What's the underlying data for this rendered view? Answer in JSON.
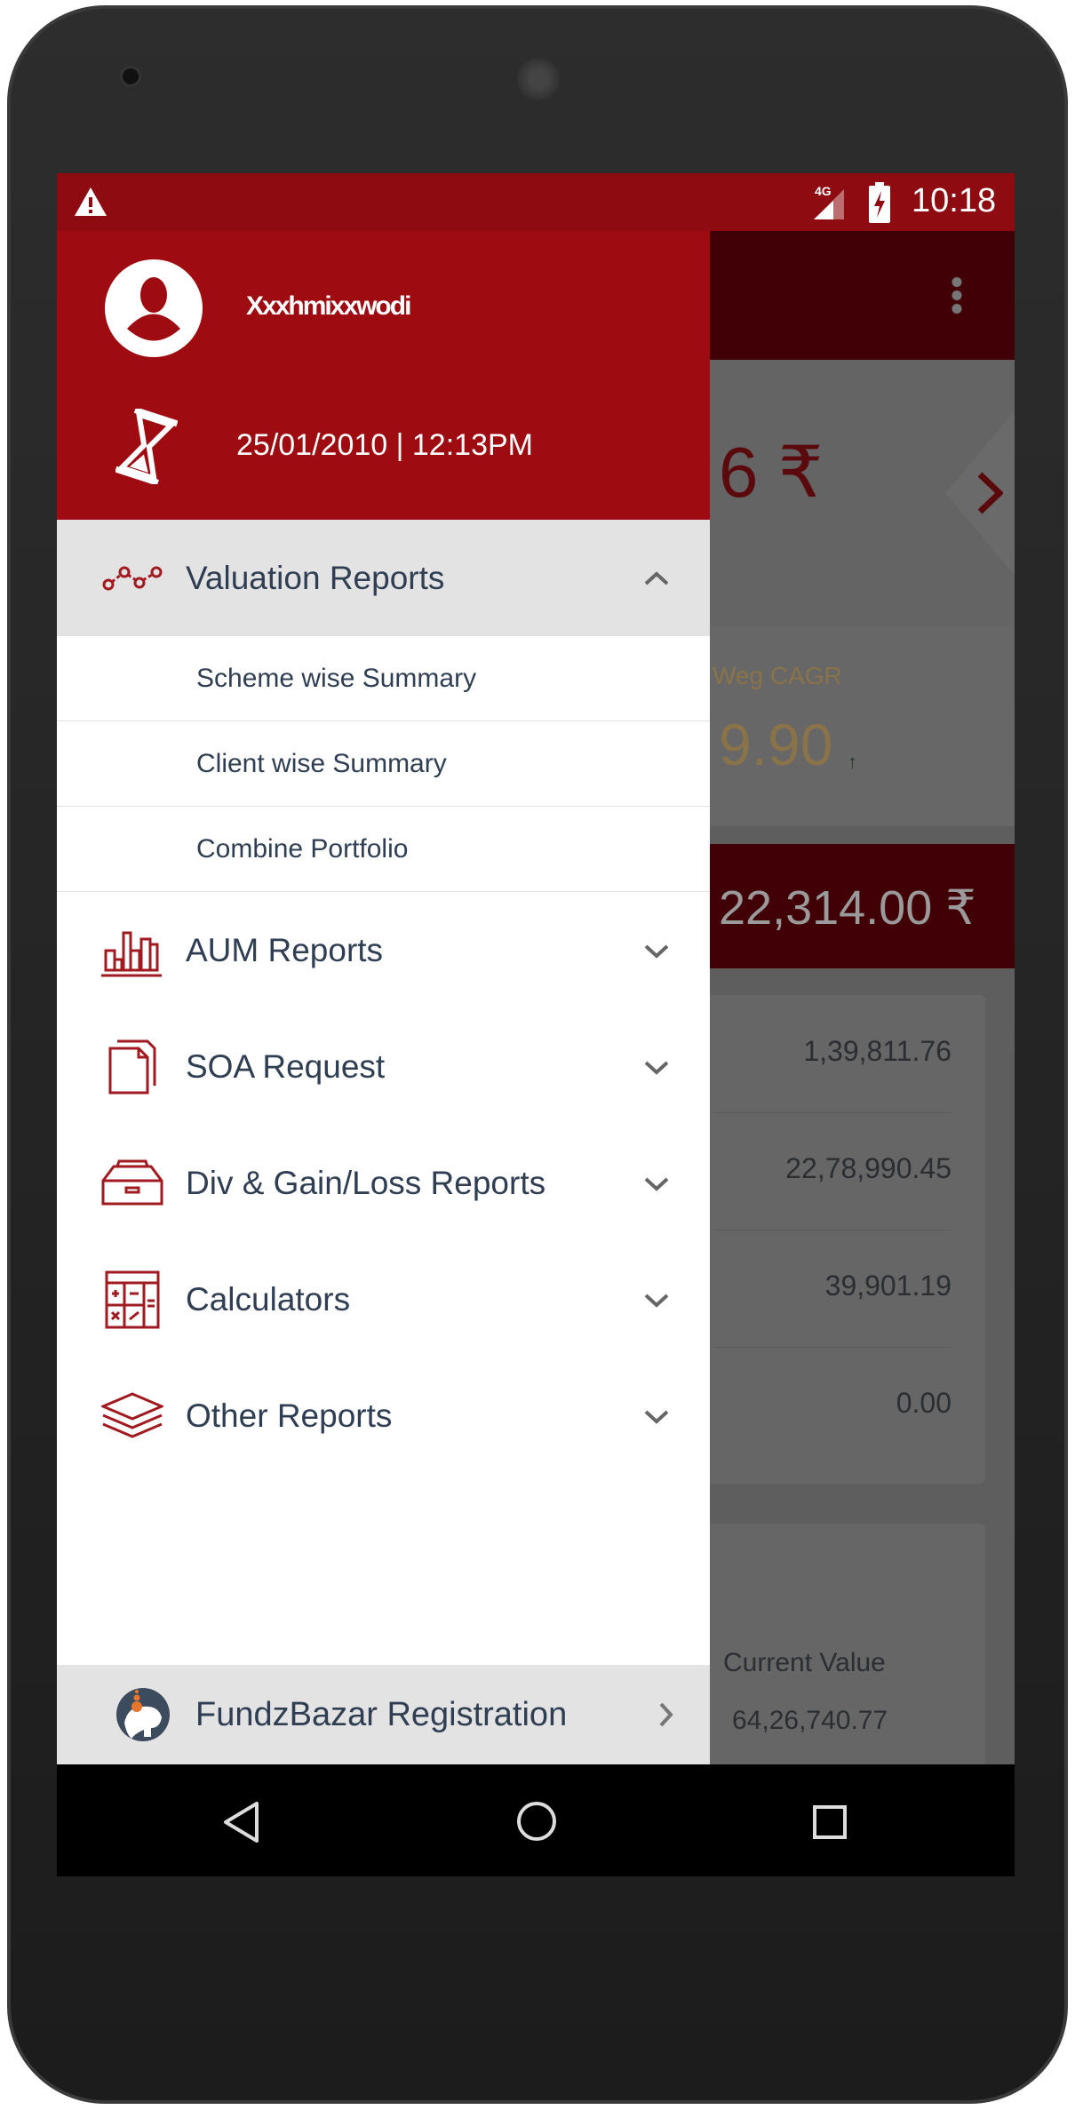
{
  "status_bar": {
    "time": "10:18",
    "network": "4G",
    "icons": [
      "warning-icon",
      "signal-icon",
      "battery-charging-icon"
    ]
  },
  "drawer": {
    "user_name": "Xxxhmixxwodi",
    "last_login": "25/01/2010 | 12:13PM",
    "menu": [
      {
        "label": "Valuation Reports",
        "icon": "line-chart-icon",
        "expanded": true,
        "children": [
          "Scheme wise Summary",
          "Client wise Summary",
          "Combine Portfolio"
        ]
      },
      {
        "label": "AUM Reports",
        "icon": "bar-chart-icon",
        "expanded": false
      },
      {
        "label": "SOA Request",
        "icon": "documents-icon",
        "expanded": false
      },
      {
        "label": "Div & Gain/Loss Reports",
        "icon": "inbox-tray-icon",
        "expanded": false
      },
      {
        "label": "Calculators",
        "icon": "calculator-icon",
        "expanded": false
      },
      {
        "label": "Other Reports",
        "icon": "layers-icon",
        "expanded": false
      }
    ],
    "footer": {
      "label": "FundzBazar Registration",
      "icon": "fundzbazar-logo-icon"
    }
  },
  "background": {
    "amount_partial": "6 ₹",
    "cagr_label": "Weg CAGR",
    "cagr_value": "9.90",
    "total_value": "22,314.00 ₹",
    "values": [
      "1,39,811.76",
      "22,78,990.45",
      "39,901.19",
      "0.00"
    ],
    "current_value_label": "Current Value",
    "current_value": "64,26,740.77"
  },
  "colors": {
    "primary": "#9e0b10",
    "status": "#8e0c11",
    "text": "#2f3e52",
    "icon": "#a11a20"
  }
}
